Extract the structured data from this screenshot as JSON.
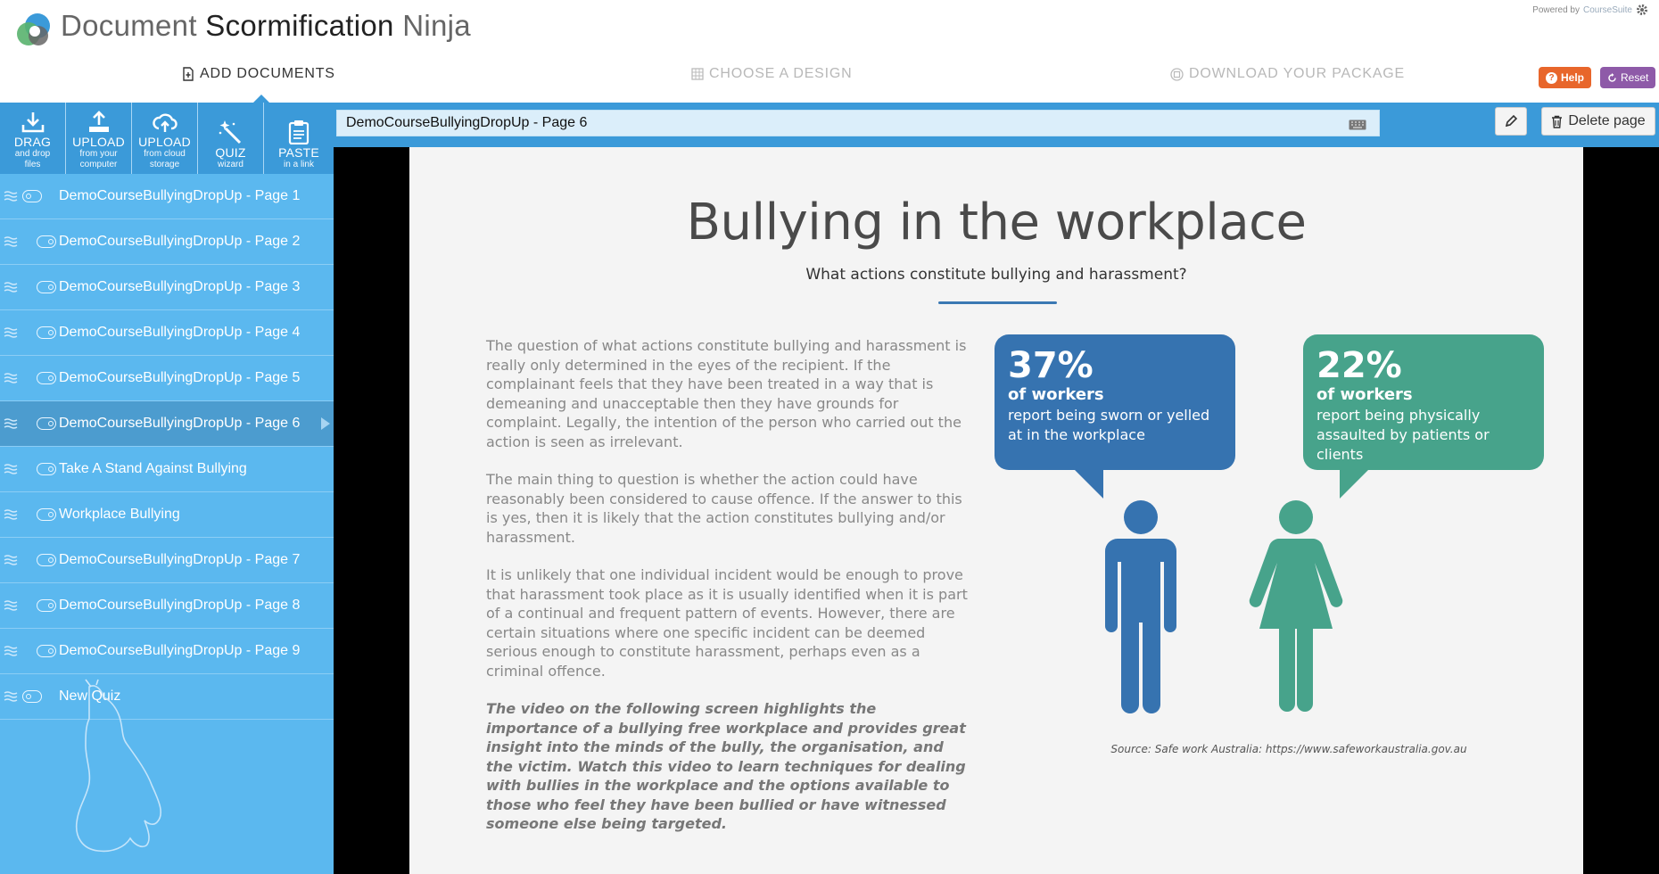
{
  "header": {
    "title_part1": "Document",
    "title_part2": "Scormification",
    "title_part3": "Ninja",
    "powered_by": "Powered by",
    "powered_brand": "CourseSuite"
  },
  "steps": [
    {
      "label": "ADD DOCUMENTS",
      "active": true
    },
    {
      "label": "CHOOSE A DESIGN",
      "active": false
    },
    {
      "label": "DOWNLOAD YOUR PACKAGE",
      "active": false
    }
  ],
  "header_buttons": {
    "help": "Help",
    "reset": "Reset"
  },
  "toolbar": [
    {
      "title": "DRAG",
      "subtitle_line1": "and drop",
      "subtitle_line2": "files",
      "icon": "download-icon"
    },
    {
      "title": "UPLOAD",
      "subtitle_line1": "from your",
      "subtitle_line2": "computer",
      "icon": "upload-icon"
    },
    {
      "title": "UPLOAD",
      "subtitle_line1": "from cloud",
      "subtitle_line2": "storage",
      "icon": "cloud-upload-icon"
    },
    {
      "title": "QUIZ",
      "subtitle_line1": "wizard",
      "subtitle_line2": "",
      "icon": "magic-wand-icon"
    },
    {
      "title": "PASTE",
      "subtitle_line1": "in a link",
      "subtitle_line2": "",
      "icon": "clipboard-icon"
    }
  ],
  "pages": [
    {
      "label": "DemoCourseBullyingDropUp - Page 1",
      "visible": false,
      "selected": false
    },
    {
      "label": "DemoCourseBullyingDropUp - Page 2",
      "visible": true,
      "selected": false
    },
    {
      "label": "DemoCourseBullyingDropUp - Page 3",
      "visible": true,
      "selected": false
    },
    {
      "label": "DemoCourseBullyingDropUp - Page 4",
      "visible": true,
      "selected": false
    },
    {
      "label": "DemoCourseBullyingDropUp - Page 5",
      "visible": true,
      "selected": false
    },
    {
      "label": "DemoCourseBullyingDropUp - Page 6",
      "visible": true,
      "selected": true
    },
    {
      "label": "Take A Stand Against Bullying",
      "visible": true,
      "selected": false
    },
    {
      "label": "Workplace Bullying",
      "visible": true,
      "selected": false
    },
    {
      "label": "DemoCourseBullyingDropUp - Page 7",
      "visible": true,
      "selected": false
    },
    {
      "label": "DemoCourseBullyingDropUp - Page 8",
      "visible": true,
      "selected": false
    },
    {
      "label": "DemoCourseBullyingDropUp - Page 9",
      "visible": true,
      "selected": false
    },
    {
      "label": "New Quiz",
      "visible": false,
      "selected": false
    }
  ],
  "editor": {
    "page_title": "DemoCourseBullyingDropUp - Page 6",
    "delete_label": "Delete page"
  },
  "slide": {
    "title": "Bullying in the workplace",
    "subtitle": "What actions constitute bullying and harassment?",
    "paragraphs": [
      "The question of what actions constitute bullying and harassment is really only determined in the eyes of the recipient. If the complainant feels that they have been treated in a way that is demeaning and unacceptable then they have grounds for complaint. Legally, the intention of the person who carried out the action is seen as irrelevant.",
      "The main thing to question is whether the action could have reasonably been considered to cause offence. If the answer to this is yes, then it is likely that the action constitutes bullying and/or harassment.",
      "It is unlikely that one individual incident would be enough to prove that harassment took place as it is usually identified when it is part of a continual and frequent pattern of events. However, there are certain situations where one specific incident can be deemed serious enough to constitute harassment, perhaps even as a criminal offence."
    ],
    "emphasis_paragraph": "The video on the following screen highlights the importance of a bullying free workplace and provides great insight into the minds of the bully, the organisation, and the victim. Watch this video to learn techniques for dealing with bullies in the workplace and the options available to those who feel they have been bullied or have witnessed someone else being targeted.",
    "stats": [
      {
        "percent": "37%",
        "of_label": "of workers",
        "description": "report being sworn or yelled at in the workplace",
        "color": "#3673b0"
      },
      {
        "percent": "22%",
        "of_label": "of workers",
        "description": "report being physically assaulted by patients or clients",
        "color": "#47a38b"
      }
    ],
    "source": "Source: Safe work Australia: https://www.safeworkaustralia.gov.au"
  },
  "colors": {
    "panel_blue": "#5bb8ef",
    "bar_blue": "#3b9ad9",
    "help_orange": "#e8662b",
    "reset_purple": "#8e5aa8"
  }
}
